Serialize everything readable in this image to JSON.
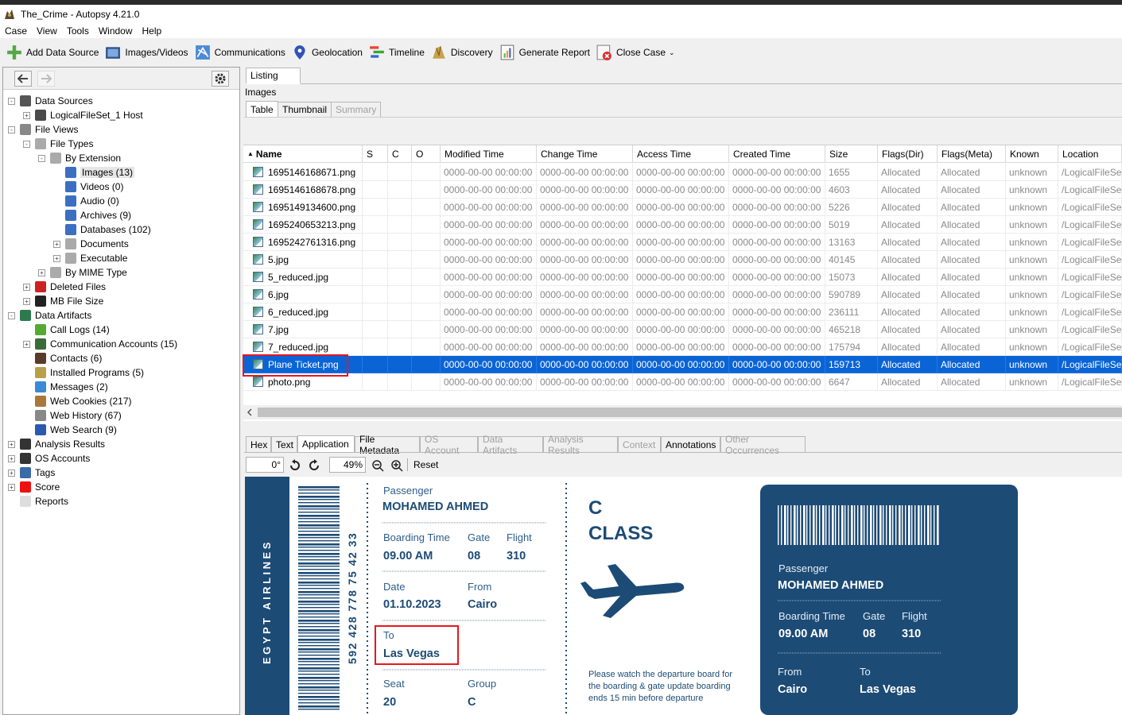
{
  "window": {
    "title": "The_Crime - Autopsy 4.21.0"
  },
  "menu": [
    "Case",
    "View",
    "Tools",
    "Window",
    "Help"
  ],
  "toolbar": [
    {
      "label": "Add Data Source",
      "icon": "add-data-source-icon"
    },
    {
      "label": "Images/Videos",
      "icon": "images-videos-icon"
    },
    {
      "label": "Communications",
      "icon": "communications-icon"
    },
    {
      "label": "Geolocation",
      "icon": "geolocation-icon"
    },
    {
      "label": "Timeline",
      "icon": "timeline-icon"
    },
    {
      "label": "Discovery",
      "icon": "discovery-icon"
    },
    {
      "label": "Generate Report",
      "icon": "report-icon"
    },
    {
      "label": "Close Case",
      "icon": "close-case-icon"
    }
  ],
  "tree": [
    {
      "label": "Data Sources",
      "depth": 0,
      "exp": "-"
    },
    {
      "label": "LogicalFileSet_1 Host",
      "depth": 1,
      "exp": "+"
    },
    {
      "label": "File Views",
      "depth": 0,
      "exp": "-"
    },
    {
      "label": "File Types",
      "depth": 1,
      "exp": "-"
    },
    {
      "label": "By Extension",
      "depth": 2,
      "exp": "-"
    },
    {
      "label": "Images (13)",
      "depth": 3,
      "exp": "",
      "selected": true
    },
    {
      "label": "Videos (0)",
      "depth": 3,
      "exp": ""
    },
    {
      "label": "Audio (0)",
      "depth": 3,
      "exp": ""
    },
    {
      "label": "Archives (9)",
      "depth": 3,
      "exp": ""
    },
    {
      "label": "Databases (102)",
      "depth": 3,
      "exp": ""
    },
    {
      "label": "Documents",
      "depth": 3,
      "exp": "+"
    },
    {
      "label": "Executable",
      "depth": 3,
      "exp": "+"
    },
    {
      "label": "By MIME Type",
      "depth": 2,
      "exp": "+"
    },
    {
      "label": "Deleted Files",
      "depth": 1,
      "exp": "+"
    },
    {
      "label": "MB File Size",
      "depth": 1,
      "exp": "+"
    },
    {
      "label": "Data Artifacts",
      "depth": 0,
      "exp": "-"
    },
    {
      "label": "Call Logs (14)",
      "depth": 1,
      "exp": ""
    },
    {
      "label": "Communication Accounts (15)",
      "depth": 1,
      "exp": "+"
    },
    {
      "label": "Contacts (6)",
      "depth": 1,
      "exp": ""
    },
    {
      "label": "Installed Programs (5)",
      "depth": 1,
      "exp": ""
    },
    {
      "label": "Messages (2)",
      "depth": 1,
      "exp": ""
    },
    {
      "label": "Web Cookies (217)",
      "depth": 1,
      "exp": ""
    },
    {
      "label": "Web History (67)",
      "depth": 1,
      "exp": ""
    },
    {
      "label": "Web Search (9)",
      "depth": 1,
      "exp": ""
    },
    {
      "label": "Analysis Results",
      "depth": 0,
      "exp": "+"
    },
    {
      "label": "OS Accounts",
      "depth": 0,
      "exp": "+"
    },
    {
      "label": "Tags",
      "depth": 0,
      "exp": "+"
    },
    {
      "label": "Score",
      "depth": 0,
      "exp": "+"
    },
    {
      "label": "Reports",
      "depth": 0,
      "exp": ""
    }
  ],
  "result_tabs": {
    "listing": "Listing",
    "section": "Images",
    "table": "Table",
    "thumbnail": "Thumbnail",
    "summary": "Summary"
  },
  "table": {
    "columns": [
      "Name",
      "S",
      "C",
      "O",
      "Modified Time",
      "Change Time",
      "Access Time",
      "Created Time",
      "Size",
      "Flags(Dir)",
      "Flags(Meta)",
      "Known",
      "Location"
    ],
    "rows": [
      {
        "name": "1695146168671.png",
        "size": "1655"
      },
      {
        "name": "1695146168678.png",
        "size": "4603"
      },
      {
        "name": "1695149134600.png",
        "size": "5226"
      },
      {
        "name": "1695240653213.png",
        "size": "5019"
      },
      {
        "name": "1695242761316.png",
        "size": "13163"
      },
      {
        "name": "5.jpg",
        "size": "40145"
      },
      {
        "name": "5_reduced.jpg",
        "size": "15073"
      },
      {
        "name": "6.jpg",
        "size": "590789"
      },
      {
        "name": "6_reduced.jpg",
        "size": "236111"
      },
      {
        "name": "7.jpg",
        "size": "465218"
      },
      {
        "name": "7_reduced.jpg",
        "size": "175794"
      },
      {
        "name": "Plane Ticket.png",
        "size": "159713",
        "selected": true
      },
      {
        "name": "photo.png",
        "size": "6647"
      }
    ],
    "time": "0000-00-00 00:00:00",
    "flags_dir": "Allocated",
    "flags_meta": "Allocated",
    "known": "unknown",
    "location": "/LogicalFileSet"
  },
  "viewer_tabs": [
    {
      "label": "Hex",
      "enabled": true
    },
    {
      "label": "Text",
      "enabled": true
    },
    {
      "label": "Application",
      "enabled": true,
      "active": true
    },
    {
      "label": "File Metadata",
      "enabled": true
    },
    {
      "label": "OS Account",
      "enabled": false
    },
    {
      "label": "Data Artifacts",
      "enabled": false
    },
    {
      "label": "Analysis Results",
      "enabled": false
    },
    {
      "label": "Context",
      "enabled": false
    },
    {
      "label": "Annotations",
      "enabled": true
    },
    {
      "label": "Other Occurrences",
      "enabled": false
    }
  ],
  "viewer": {
    "rotation": "0°",
    "zoom": "49%",
    "reset": "Reset"
  },
  "ticket": {
    "airline": "EGYPT AIRLINES",
    "number": "592 428 778 75 42 33",
    "passenger_label": "Passenger",
    "passenger": "MOHAMED AHMED",
    "boarding_label": "Boarding Time",
    "boarding": "09.00 AM",
    "gate_label": "Gate",
    "gate": "08",
    "flight_label": "Flight",
    "flight": "310",
    "date_label": "Date",
    "date": "01.10.2023",
    "from_label": "From",
    "from": "Cairo",
    "to_label": "To",
    "to": "Las Vegas",
    "seat_label": "Seat",
    "seat": "20",
    "group_label": "Group",
    "group": "C",
    "class_letter": "C",
    "class_word": "CLASS",
    "notice": [
      "Please watch the departure board for",
      "the boarding & gate update boarding",
      "ends 15 min before departure"
    ],
    "colors": {
      "navy": "#1c4b76"
    }
  }
}
